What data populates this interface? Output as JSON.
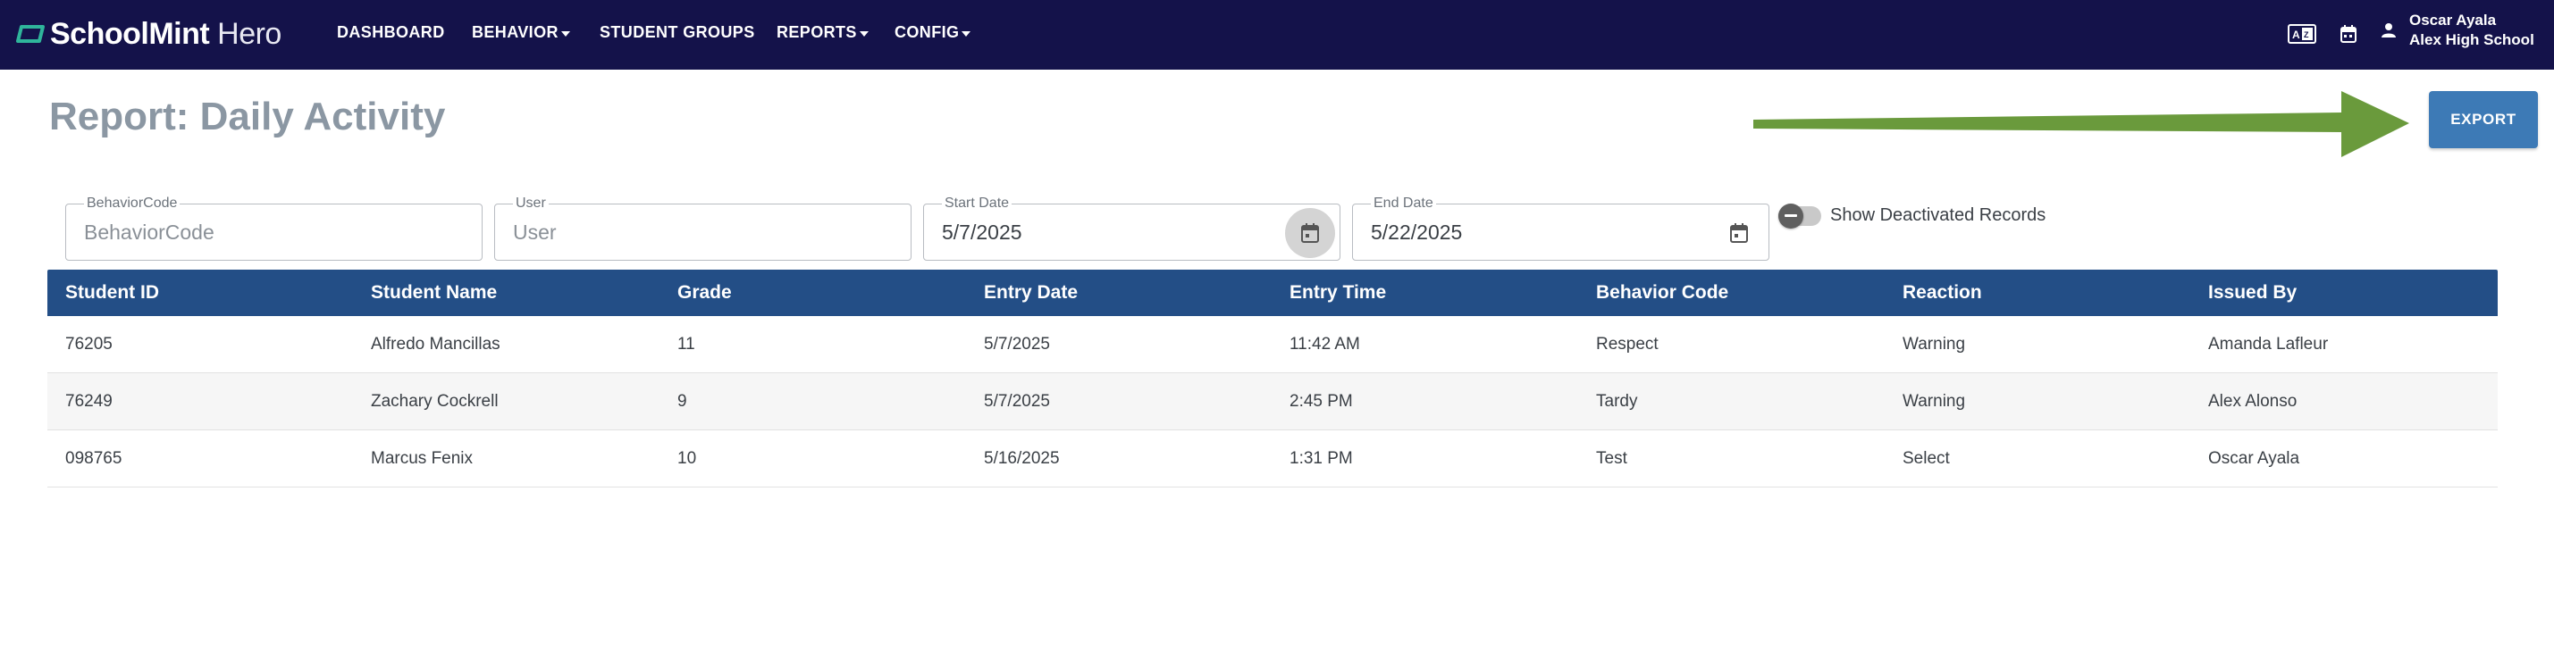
{
  "app": {
    "logo_bold": "SchoolMint",
    "logo_light": " Hero",
    "brand_color": "#14124a"
  },
  "nav": {
    "items": [
      {
        "label": "DASHBOARD",
        "dropdown": false
      },
      {
        "label": "BEHAVIOR",
        "dropdown": true
      },
      {
        "label": "STUDENT GROUPS",
        "dropdown": false
      },
      {
        "label": "REPORTS",
        "dropdown": true
      },
      {
        "label": "CONFIG",
        "dropdown": true
      }
    ],
    "icons": [
      "translate-icon",
      "calendar-icon",
      "person-icon"
    ],
    "user_name": "Oscar Ayala",
    "user_school": "Alex High School"
  },
  "page": {
    "title": "Report: Daily Activity",
    "export_label": "EXPORT",
    "export_color": "#3d7ab6",
    "arrow_color": "#6a9a3c"
  },
  "filters": {
    "behavior_code": {
      "label": "BehaviorCode",
      "placeholder": "BehaviorCode",
      "value": ""
    },
    "user": {
      "label": "User",
      "placeholder": "User",
      "value": ""
    },
    "start_date": {
      "label": "Start Date",
      "value": "5/7/2025"
    },
    "end_date": {
      "label": "End Date",
      "value": "5/22/2025"
    },
    "show_deactivated": {
      "label": "Show Deactivated Records",
      "checked": false
    }
  },
  "table": {
    "header_color": "#234e86",
    "columns": [
      "Student ID",
      "Student Name",
      "Grade",
      "Entry Date",
      "Entry Time",
      "Behavior Code",
      "Reaction",
      "Issued By"
    ],
    "rows": [
      [
        "76205",
        "Alfredo Mancillas",
        "11",
        "5/7/2025",
        "11:42 AM",
        "Respect",
        "Warning",
        "Amanda Lafleur"
      ],
      [
        "76249",
        "Zachary Cockrell",
        "9",
        "5/7/2025",
        "2:45 PM",
        "Tardy",
        "Warning",
        "Alex Alonso"
      ],
      [
        "098765",
        "Marcus Fenix",
        "10",
        "5/16/2025",
        "1:31 PM",
        "Test",
        "Select",
        "Oscar Ayala"
      ]
    ]
  }
}
